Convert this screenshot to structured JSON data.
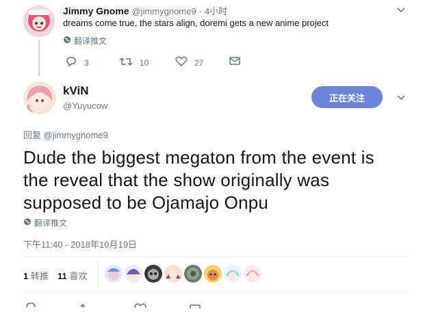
{
  "parent_tweet": {
    "name": "Jimmy Gnome",
    "handle": "@jimmygnome9",
    "separator": "·",
    "time": "4小时",
    "text": "dreams come true, the stars align, doremi gets a new anime project",
    "translate_label": "翻译推文",
    "replies": "3",
    "retweets": "10",
    "likes": "27"
  },
  "main_tweet": {
    "name": "kViN",
    "handle": "@Yuyucow",
    "follow_label": "正在关注",
    "reply_prefix": "回复",
    "reply_to": "@jimmygnome9",
    "text_line1": "Dude the biggest megaton from the event is",
    "text_line2": "the reveal that the show originally was",
    "text_line3": "supposed to be Ojamajo Onpu",
    "translate_label": "翻译推文",
    "timestamp": "下午11:40 - 2018年10月19日",
    "retweet_count": "1",
    "retweet_label": "转推",
    "like_count": "11",
    "like_label": "喜欢"
  },
  "colors": {
    "accent": "#6d85d8",
    "muted": "#657786",
    "text": "#14171a"
  },
  "likers": [
    "liker-avatar-1",
    "liker-avatar-2",
    "liker-avatar-3",
    "liker-avatar-4",
    "liker-avatar-5",
    "liker-avatar-6",
    "liker-avatar-7",
    "liker-avatar-8"
  ]
}
